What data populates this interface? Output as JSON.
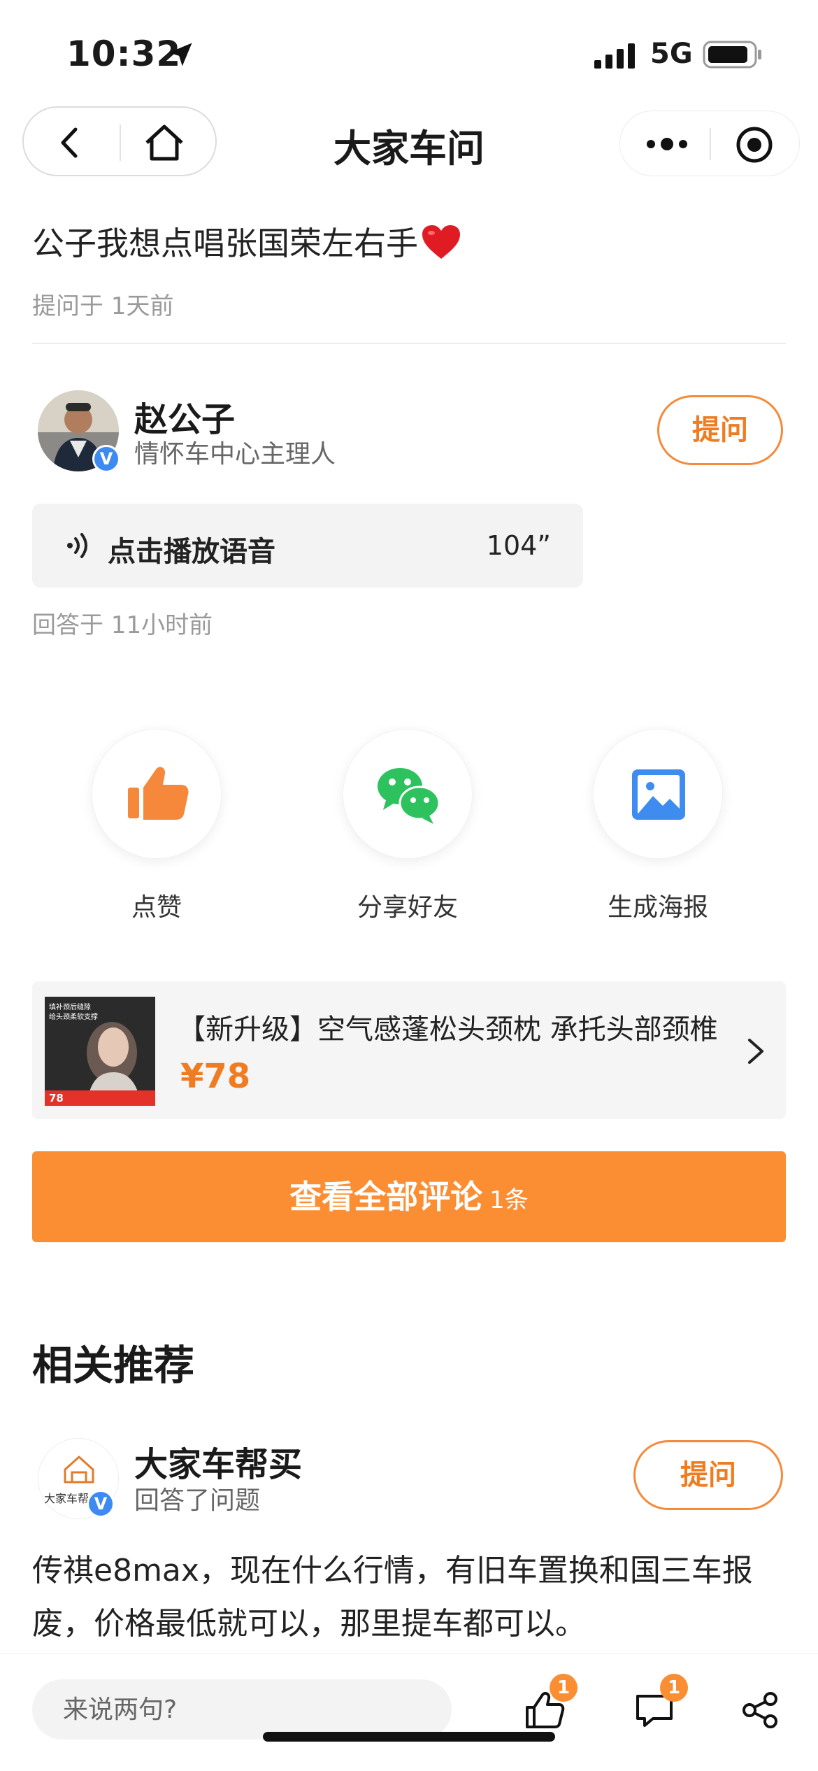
{
  "status_bar": {
    "time": "10:32",
    "network": "5G"
  },
  "nav": {
    "title": "大家车问"
  },
  "question": {
    "text": "公子我想点唱张国荣左右手",
    "time": "提问于 1天前"
  },
  "answerer": {
    "name": "赵公子",
    "role": "情怀车中心主理人",
    "verified_mark": "V",
    "ask_label": "提问"
  },
  "voice": {
    "label": "点击播放语音",
    "duration": "104”"
  },
  "answer_time": "回答于 11小时前",
  "actions": [
    {
      "label": "点赞"
    },
    {
      "label": "分享好友"
    },
    {
      "label": "生成海报"
    }
  ],
  "product": {
    "title": "【新升级】空气感蓬松头颈枕 承托头部颈椎",
    "price": "¥78",
    "image_caption_1": "填补颈后缝隙",
    "image_caption_2": "给头颈柔软支撑",
    "image_price": "78"
  },
  "comments": {
    "label": "查看全部评论",
    "count": "1条"
  },
  "recommend": {
    "section_title": "相关推荐",
    "name": "大家车帮买",
    "logo_text": "大家车帮",
    "verified_mark": "V",
    "sub": "回答了问题",
    "ask_label": "提问",
    "question": "传祺e8max，现在什么行情，有旧车置换和国三车报废，价格最低就可以，那里提车都可以。"
  },
  "bottom_bar": {
    "input_placeholder": "来说两句?",
    "like_badge": "1",
    "comment_badge": "1"
  },
  "colors": {
    "accent": "#fb8d32",
    "accent_text": "#f07c22",
    "verified": "#3d8bf2",
    "wechat_green": "#2ec25f",
    "poster_blue": "#3f8cf0",
    "heart_red": "#e01b24"
  }
}
